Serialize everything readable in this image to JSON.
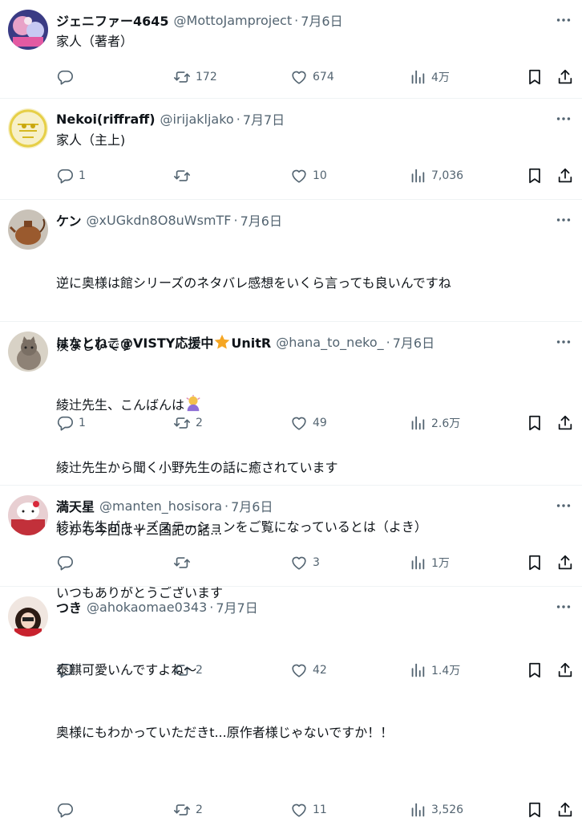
{
  "colors": {
    "text": "#0f1419",
    "secondary": "#536471",
    "divider": "#eff3f4"
  },
  "icons": [
    "reply-icon",
    "repost-icon",
    "like-icon",
    "views-icon",
    "bookmark-icon",
    "share-icon",
    "more-icon"
  ],
  "posts": [
    {
      "name": "ジェニファー4645",
      "handle": "@MottoJamproject",
      "date": "7月6日",
      "lines": [
        "家人（著者）"
      ],
      "replies": "",
      "reposts": "172",
      "likes": "674",
      "views": "4万"
    },
    {
      "name": "Nekoi(riffraff)",
      "handle": "@irijakljako",
      "date": "7月7日",
      "lines": [
        "家人（主上)"
      ],
      "replies": "1",
      "reposts": "",
      "likes": "10",
      "views": "7,036"
    },
    {
      "name": "ケン",
      "handle": "@xUGkdn8O8uWsmTF",
      "date": "7月6日",
      "lines": [
        "逆に奥様は館シリーズのネタバレ感想をいくら言っても良いんですね",
        "羨ましいです"
      ],
      "replies": "1",
      "reposts": "2",
      "likes": "49",
      "views": "2.6万"
    },
    {
      "name": "はなとねこ@VISTY応援中",
      "name_suffix": "UnitR",
      "handle": "@hana_to_neko_",
      "date": "7月6日",
      "line1": "綾辻先生、こんばんは",
      "lines_rest": [
        "綾辻先生から聞く小野先生の話に癒されています",
        "しかも今回は十二国記の話...",
        "いつもありがとうございます"
      ],
      "replies": "",
      "reposts": "2",
      "likes": "42",
      "views": "1.4万"
    },
    {
      "name": "満天星",
      "handle": "@manten_hosisora",
      "date": "7月6日",
      "lines": [
        "綾辻先生がキッズステーションをご覧になっているとは（よき）"
      ],
      "replies": "",
      "reposts": "",
      "likes": "3",
      "views": "1万"
    },
    {
      "name": "つき",
      "handle": "@ahokaomae0343",
      "date": "7月7日",
      "lines": [
        "泰麒可愛いんですよね〜",
        "奥様にもわかっていただきt...原作者様じゃないですか！！"
      ],
      "replies": "",
      "reposts": "2",
      "likes": "11",
      "views": "3,526"
    }
  ]
}
